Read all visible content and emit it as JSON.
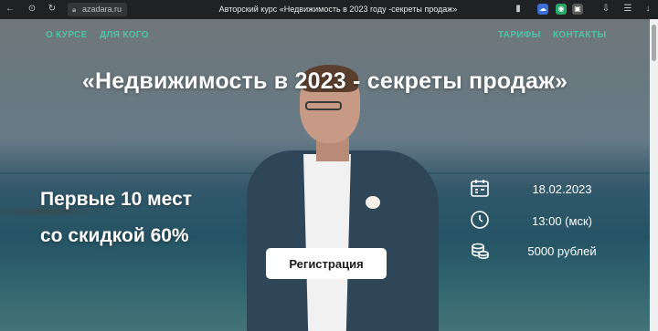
{
  "browser": {
    "url": "azadara.ru",
    "page_title": "Авторский курс «Недвижимость в 2023 году -секреты продаж»"
  },
  "nav": {
    "about": "О КУРСЕ",
    "for_whom": "ДЛЯ КОГО",
    "tariffs": "ТАРИФЫ",
    "contacts": "КОНТАКТЫ"
  },
  "hero": {
    "headline": "«Недвижимость в 2023 - секреты продаж»",
    "offer_line1": "Первые 10 мест",
    "offer_line2": "со скидкой 60%"
  },
  "info": {
    "date": "18.02.2023",
    "time": "13:00 (мск)",
    "price": "5000 рублей"
  },
  "cta": {
    "register_label": "Регистрация"
  },
  "colors": {
    "nav_accent": "#4fc3a8",
    "button_bg": "#ffffff",
    "text_light": "#ffffff"
  },
  "icons": {
    "calendar": "calendar-icon",
    "clock": "clock-icon",
    "coins": "coins-icon"
  }
}
